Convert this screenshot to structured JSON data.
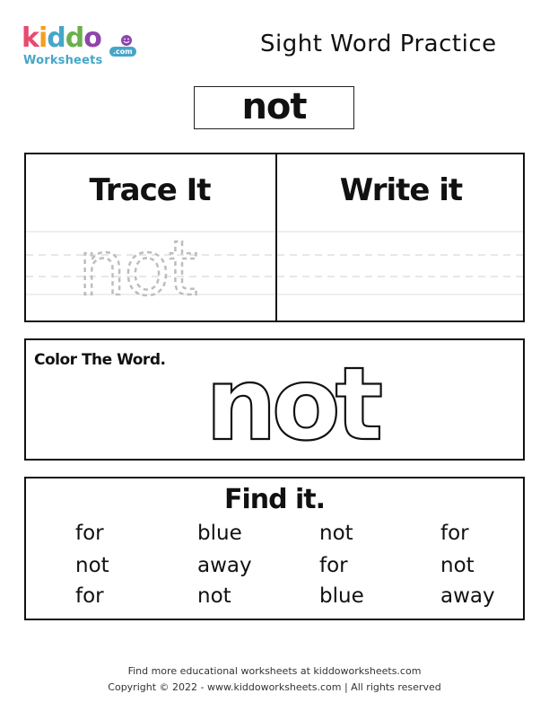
{
  "logo": {
    "letters": [
      {
        "char": "k",
        "color": "#e84a6f"
      },
      {
        "char": "i",
        "color": "#f4a01c"
      },
      {
        "char": "d",
        "color": "#46a6c8"
      },
      {
        "char": "d",
        "color": "#6ab04c"
      },
      {
        "char": "o",
        "color": "#8e44ad"
      }
    ],
    "subtitle": "Worksheets",
    "domain_badge": ".com"
  },
  "header": {
    "title": "Sight Word Practice"
  },
  "word": "not",
  "trace_panel": {
    "trace_heading": "Trace It",
    "write_heading": "Write it",
    "trace_word": "not"
  },
  "color_panel": {
    "label": "Color The Word.",
    "word": "not"
  },
  "find_panel": {
    "heading": "Find it.",
    "rows": [
      [
        "for",
        "blue",
        "not",
        "for"
      ],
      [
        "not",
        "away",
        "for",
        "not"
      ],
      [
        "for",
        "not",
        "blue",
        "away"
      ]
    ]
  },
  "footer": {
    "line1": "Find more educational worksheets at kiddoworksheets.com",
    "line2": "Copyright © 2022 - www.kiddoworksheets.com  |  All rights reserved"
  }
}
